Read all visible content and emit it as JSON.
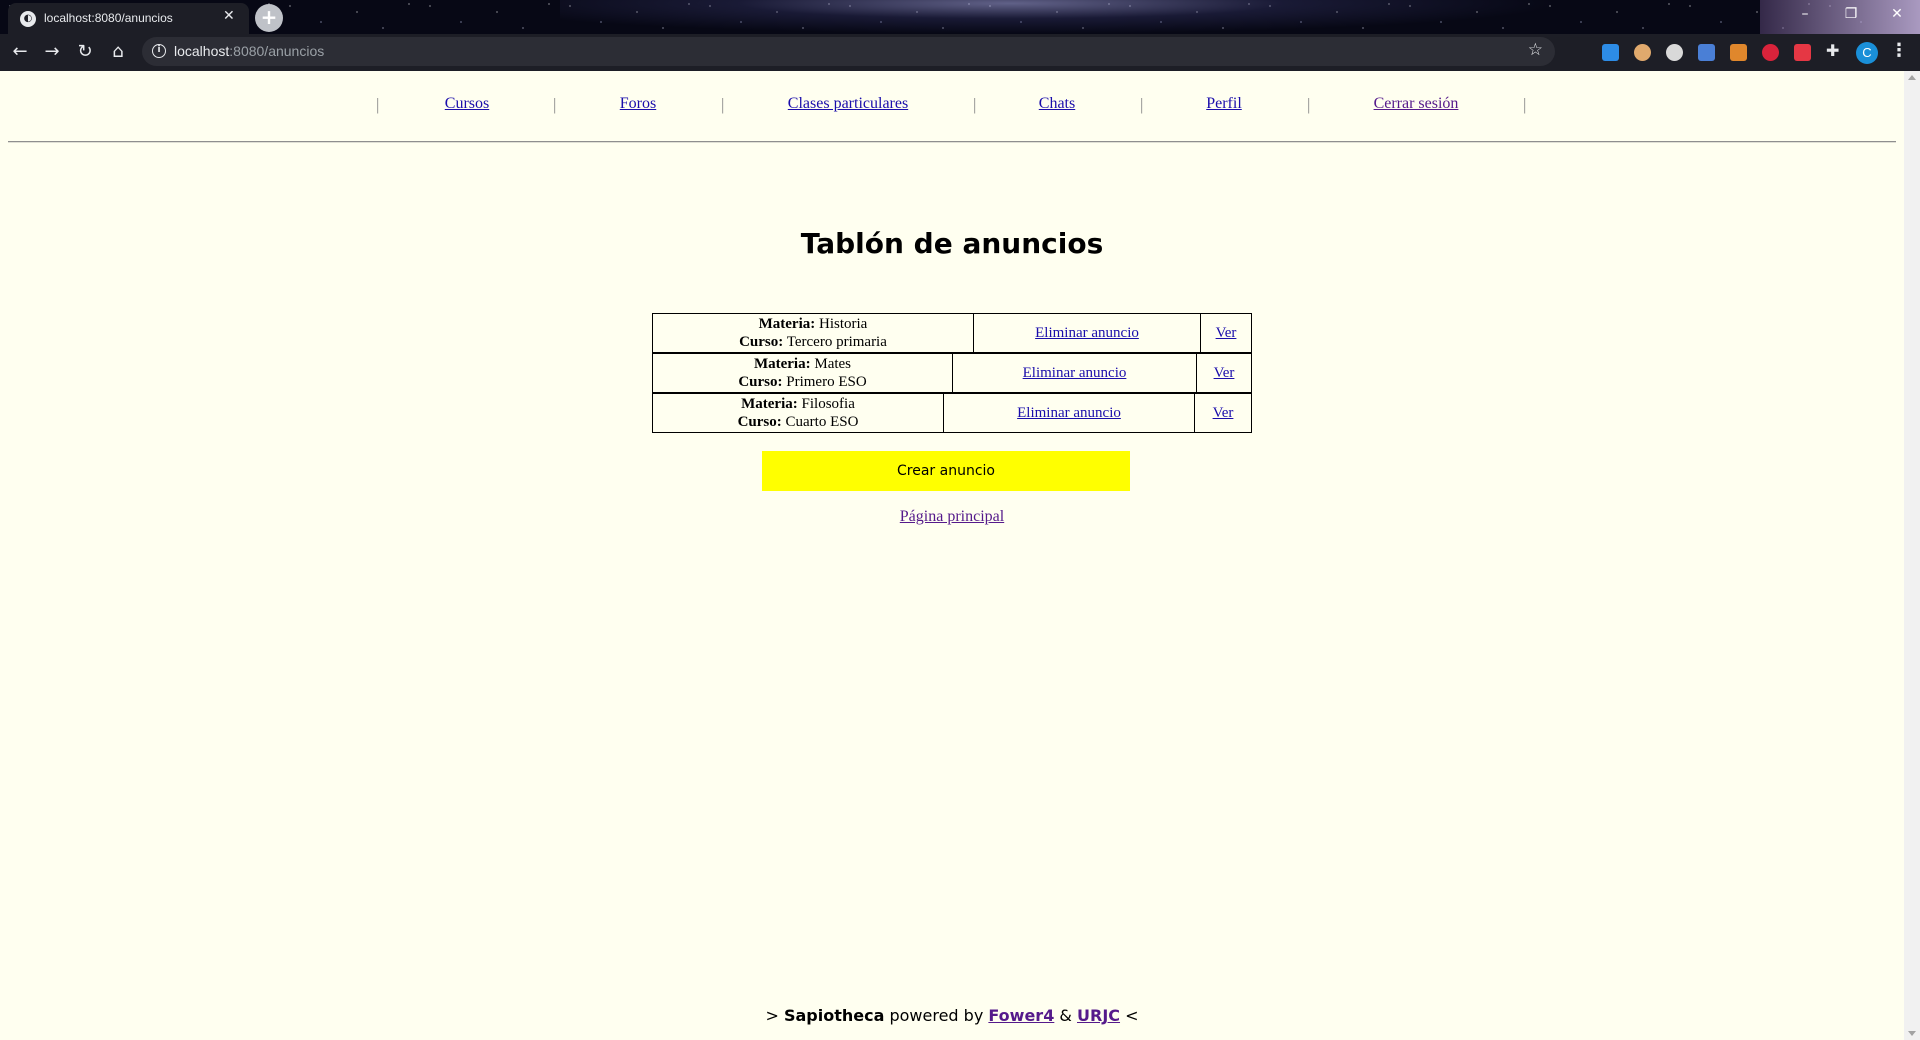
{
  "browser": {
    "tab_title": "localhost:8080/anuncios",
    "url_host": "localhost",
    "url_path": ":8080/anuncios",
    "profile_initial": "C",
    "accent": "#1a8fd8"
  },
  "nav": {
    "items": [
      "Cursos",
      "Foros",
      "Clases particulares",
      "Chats",
      "Perfil",
      "Cerrar sesión"
    ],
    "separator": "|"
  },
  "page": {
    "title": "Tablón de anuncios",
    "materia_label": "Materia:",
    "curso_label": "Curso:",
    "ads": [
      {
        "materia": "Historia",
        "curso": "Tercero primaria",
        "delete_label": "Eliminar anuncio",
        "view_label": "Ver"
      },
      {
        "materia": "Mates",
        "curso": "Primero ESO",
        "delete_label": "Eliminar anuncio",
        "view_label": "Ver"
      },
      {
        "materia": "Filosofia",
        "curso": "Cuarto ESO",
        "delete_label": "Eliminar anuncio",
        "view_label": "Ver"
      }
    ],
    "create_button": "Crear anuncio",
    "create_button_color": "#ffff00",
    "home_link": "Página principal"
  },
  "footer": {
    "prefix": ">",
    "brand": "Sapiotheca",
    "powered": "powered by",
    "link1": "Fower4",
    "amp": "&",
    "link2": "URJC",
    "suffix": "<"
  }
}
